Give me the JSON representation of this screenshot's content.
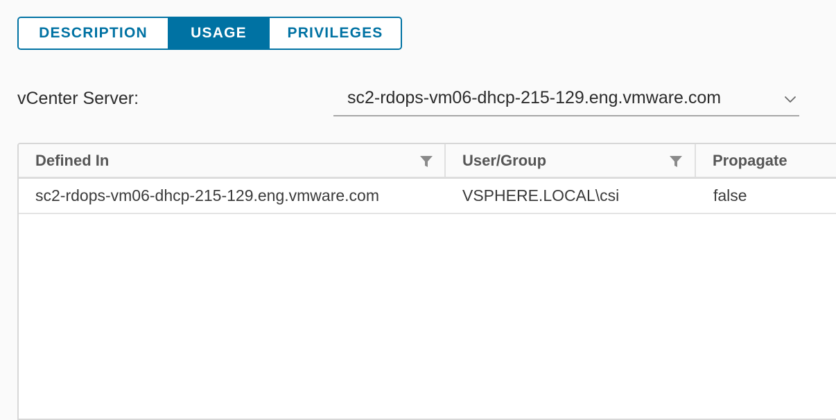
{
  "tabs": [
    {
      "label": "DESCRIPTION",
      "active": false
    },
    {
      "label": "USAGE",
      "active": true
    },
    {
      "label": "PRIVILEGES",
      "active": false
    }
  ],
  "vcenter": {
    "label": "vCenter Server:",
    "selected": "sc2-rdops-vm06-dhcp-215-129.eng.vmware.com"
  },
  "grid": {
    "columns": [
      "Defined In",
      "User/Group",
      "Propagate"
    ],
    "rows": [
      [
        "sc2-rdops-vm06-dhcp-215-129.eng.vmware.com",
        "VSPHERE.LOCAL\\csi",
        "false"
      ]
    ]
  },
  "icons": {
    "column_filter": "filter-icon",
    "select_chevron": "chevron-down-icon"
  },
  "colors": {
    "accent": "#0072a3",
    "background": "#fafafa"
  }
}
